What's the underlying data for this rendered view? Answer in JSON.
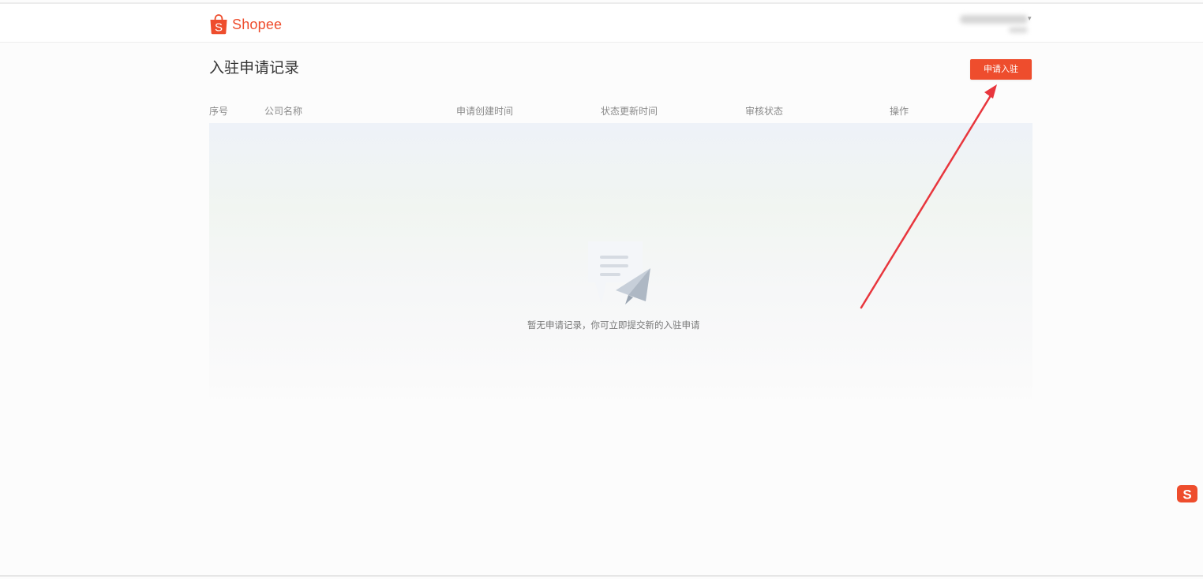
{
  "header": {
    "logo_text": "Shopee",
    "logo_icon": "shopee-bag-icon"
  },
  "page": {
    "title": "入驻申请记录",
    "apply_button_label": "申请入驻"
  },
  "table": {
    "columns": [
      "序号",
      "公司名称",
      "申请创建时间",
      "状态更新时间",
      "审核状态",
      "操作"
    ],
    "rows": [],
    "empty_text": "暂无申请记录，你可立即提交新的入驻申请",
    "empty_icon": "paper-plane-document-icon"
  },
  "colors": {
    "brand": "#ee4d2d",
    "annotation_arrow": "#e8363d"
  }
}
